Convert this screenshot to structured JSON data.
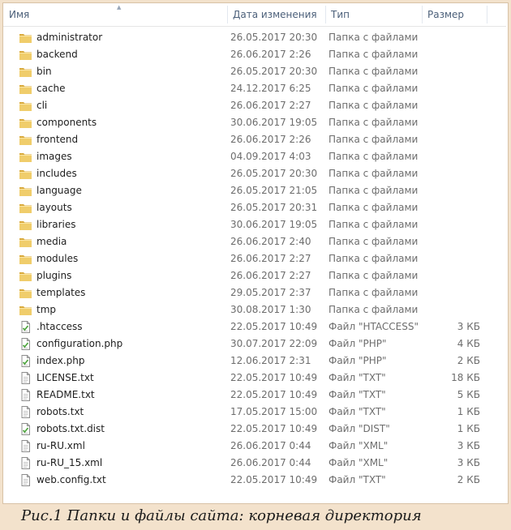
{
  "columns": {
    "name": "Имя",
    "date": "Дата изменения",
    "type": "Тип",
    "size": "Размер"
  },
  "files": [
    {
      "name": "administrator",
      "date": "26.05.2017 20:30",
      "type": "Папка с файлами",
      "size": "",
      "icon": "folder-icon"
    },
    {
      "name": "backend",
      "date": "26.06.2017 2:26",
      "type": "Папка с файлами",
      "size": "",
      "icon": "folder-icon"
    },
    {
      "name": "bin",
      "date": "26.05.2017 20:30",
      "type": "Папка с файлами",
      "size": "",
      "icon": "folder-icon"
    },
    {
      "name": "cache",
      "date": "24.12.2017 6:25",
      "type": "Папка с файлами",
      "size": "",
      "icon": "folder-icon"
    },
    {
      "name": "cli",
      "date": "26.06.2017 2:27",
      "type": "Папка с файлами",
      "size": "",
      "icon": "folder-icon"
    },
    {
      "name": "components",
      "date": "30.06.2017 19:05",
      "type": "Папка с файлами",
      "size": "",
      "icon": "folder-icon"
    },
    {
      "name": "frontend",
      "date": "26.06.2017 2:26",
      "type": "Папка с файлами",
      "size": "",
      "icon": "folder-icon"
    },
    {
      "name": "images",
      "date": "04.09.2017 4:03",
      "type": "Папка с файлами",
      "size": "",
      "icon": "folder-icon"
    },
    {
      "name": "includes",
      "date": "26.05.2017 20:30",
      "type": "Папка с файлами",
      "size": "",
      "icon": "folder-icon"
    },
    {
      "name": "language",
      "date": "26.05.2017 21:05",
      "type": "Папка с файлами",
      "size": "",
      "icon": "folder-icon"
    },
    {
      "name": "layouts",
      "date": "26.05.2017 20:31",
      "type": "Папка с файлами",
      "size": "",
      "icon": "folder-icon"
    },
    {
      "name": "libraries",
      "date": "30.06.2017 19:05",
      "type": "Папка с файлами",
      "size": "",
      "icon": "folder-icon"
    },
    {
      "name": "media",
      "date": "26.06.2017 2:40",
      "type": "Папка с файлами",
      "size": "",
      "icon": "folder-icon"
    },
    {
      "name": "modules",
      "date": "26.06.2017 2:27",
      "type": "Папка с файлами",
      "size": "",
      "icon": "folder-icon"
    },
    {
      "name": "plugins",
      "date": "26.06.2017 2:27",
      "type": "Папка с файлами",
      "size": "",
      "icon": "folder-icon"
    },
    {
      "name": "templates",
      "date": "29.05.2017 2:37",
      "type": "Папка с файлами",
      "size": "",
      "icon": "folder-icon"
    },
    {
      "name": "tmp",
      "date": "30.08.2017 1:30",
      "type": "Папка с файлами",
      "size": "",
      "icon": "folder-icon"
    },
    {
      "name": ".htaccess",
      "date": "22.05.2017 10:49",
      "type": "Файл \"HTACCESS\"",
      "size": "3 КБ",
      "icon": "script-file-icon"
    },
    {
      "name": "configuration.php",
      "date": "30.07.2017 22:09",
      "type": "Файл \"PHP\"",
      "size": "4 КБ",
      "icon": "script-file-icon"
    },
    {
      "name": "index.php",
      "date": "12.06.2017 2:31",
      "type": "Файл \"PHP\"",
      "size": "2 КБ",
      "icon": "script-file-icon"
    },
    {
      "name": "LICENSE.txt",
      "date": "22.05.2017 10:49",
      "type": "Файл \"TXT\"",
      "size": "18 КБ",
      "icon": "text-file-icon"
    },
    {
      "name": "README.txt",
      "date": "22.05.2017 10:49",
      "type": "Файл \"TXT\"",
      "size": "5 КБ",
      "icon": "text-file-icon"
    },
    {
      "name": "robots.txt",
      "date": "17.05.2017 15:00",
      "type": "Файл \"TXT\"",
      "size": "1 КБ",
      "icon": "text-file-icon"
    },
    {
      "name": "robots.txt.dist",
      "date": "22.05.2017 10:49",
      "type": "Файл \"DIST\"",
      "size": "1 КБ",
      "icon": "script-file-icon"
    },
    {
      "name": "ru-RU.xml",
      "date": "26.06.2017 0:44",
      "type": "Файл \"XML\"",
      "size": "3 КБ",
      "icon": "text-file-icon"
    },
    {
      "name": "ru-RU_15.xml",
      "date": "26.06.2017 0:44",
      "type": "Файл \"XML\"",
      "size": "3 КБ",
      "icon": "text-file-icon"
    },
    {
      "name": "web.config.txt",
      "date": "22.05.2017 10:49",
      "type": "Файл \"TXT\"",
      "size": "2 КБ",
      "icon": "text-file-icon"
    }
  ],
  "caption": "Рис.1   Папки и файлы сайта: корневая директория",
  "colors": {
    "header_text": "#4c607a",
    "folder": "#e8c25a",
    "caption_bg": "#f3e2cc"
  }
}
